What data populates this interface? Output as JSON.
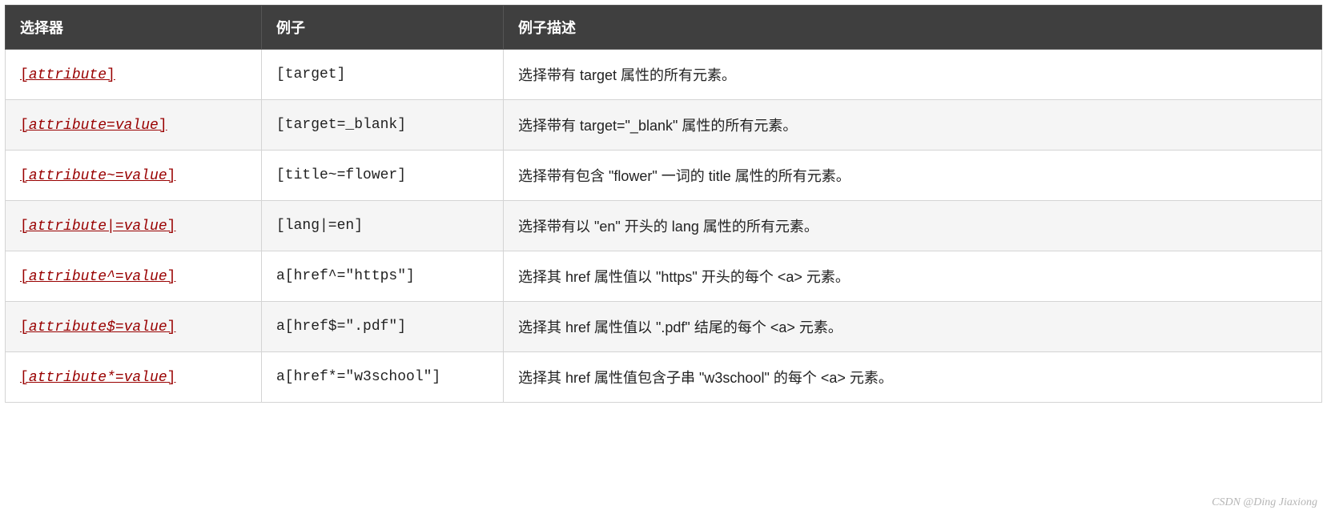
{
  "headers": {
    "selector": "选择器",
    "example": "例子",
    "description": "例子描述"
  },
  "rows": [
    {
      "selector_inner": "attribute",
      "example": "[target]",
      "description": "选择带有 target 属性的所有元素。"
    },
    {
      "selector_inner": "attribute=value",
      "example": "[target=_blank]",
      "description": "选择带有 target=\"_blank\" 属性的所有元素。"
    },
    {
      "selector_inner": "attribute~=value",
      "example": "[title~=flower]",
      "description": "选择带有包含 \"flower\" 一词的 title 属性的所有元素。"
    },
    {
      "selector_inner": "attribute|=value",
      "example": "[lang|=en]",
      "description": "选择带有以 \"en\" 开头的 lang 属性的所有元素。"
    },
    {
      "selector_inner": "attribute^=value",
      "example": "a[href^=\"https\"]",
      "description": "选择其 href 属性值以 \"https\" 开头的每个 <a> 元素。"
    },
    {
      "selector_inner": "attribute$=value",
      "example": "a[href$=\".pdf\"]",
      "description": "选择其 href 属性值以 \".pdf\" 结尾的每个 <a> 元素。"
    },
    {
      "selector_inner": "attribute*=value",
      "example": "a[href*=\"w3school\"]",
      "description": "选择其 href 属性值包含子串 \"w3school\" 的每个 <a> 元素。"
    }
  ],
  "watermark": "CSDN @Ding Jiaxiong"
}
